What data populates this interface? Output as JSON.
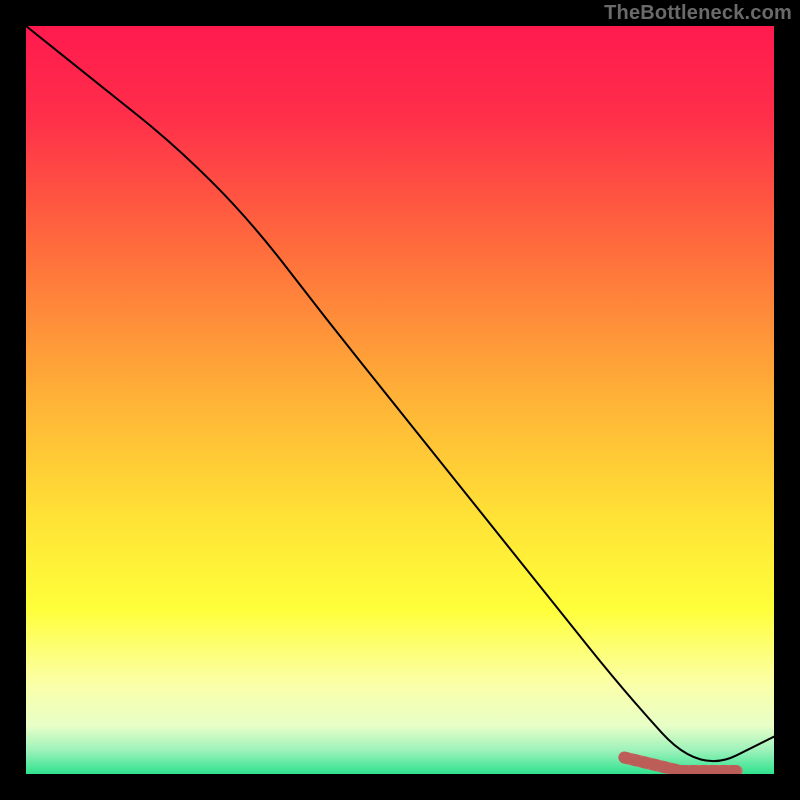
{
  "watermark": "TheBottleneck.com",
  "chart_data": {
    "type": "line",
    "title": "",
    "xlabel": "",
    "ylabel": "",
    "xlim": [
      0,
      100
    ],
    "ylim": [
      0,
      100
    ],
    "categories": [
      0,
      10,
      20,
      30,
      40,
      50,
      60,
      70,
      80,
      90,
      100
    ],
    "series": [
      {
        "name": "bottleneck-curve",
        "values": [
          100,
          92,
          84,
          74,
          61,
          48.5,
          36,
          23.5,
          11,
          0,
          5
        ],
        "color": "#000000"
      }
    ],
    "highlight": {
      "name": "optimal-range",
      "x_range": [
        80,
        95
      ],
      "y_range": [
        0,
        3
      ],
      "color": "#cf6360"
    },
    "background_gradient": {
      "stops": [
        {
          "pos": 0.0,
          "color": "#ff1a4e"
        },
        {
          "pos": 0.12,
          "color": "#ff2e4a"
        },
        {
          "pos": 0.3,
          "color": "#ff6d3c"
        },
        {
          "pos": 0.5,
          "color": "#ffb337"
        },
        {
          "pos": 0.66,
          "color": "#ffe336"
        },
        {
          "pos": 0.78,
          "color": "#ffff3a"
        },
        {
          "pos": 0.88,
          "color": "#fbffa8"
        },
        {
          "pos": 0.935,
          "color": "#e8ffc7"
        },
        {
          "pos": 0.968,
          "color": "#9ef2bb"
        },
        {
          "pos": 1.0,
          "color": "#2fe28e"
        }
      ]
    }
  }
}
